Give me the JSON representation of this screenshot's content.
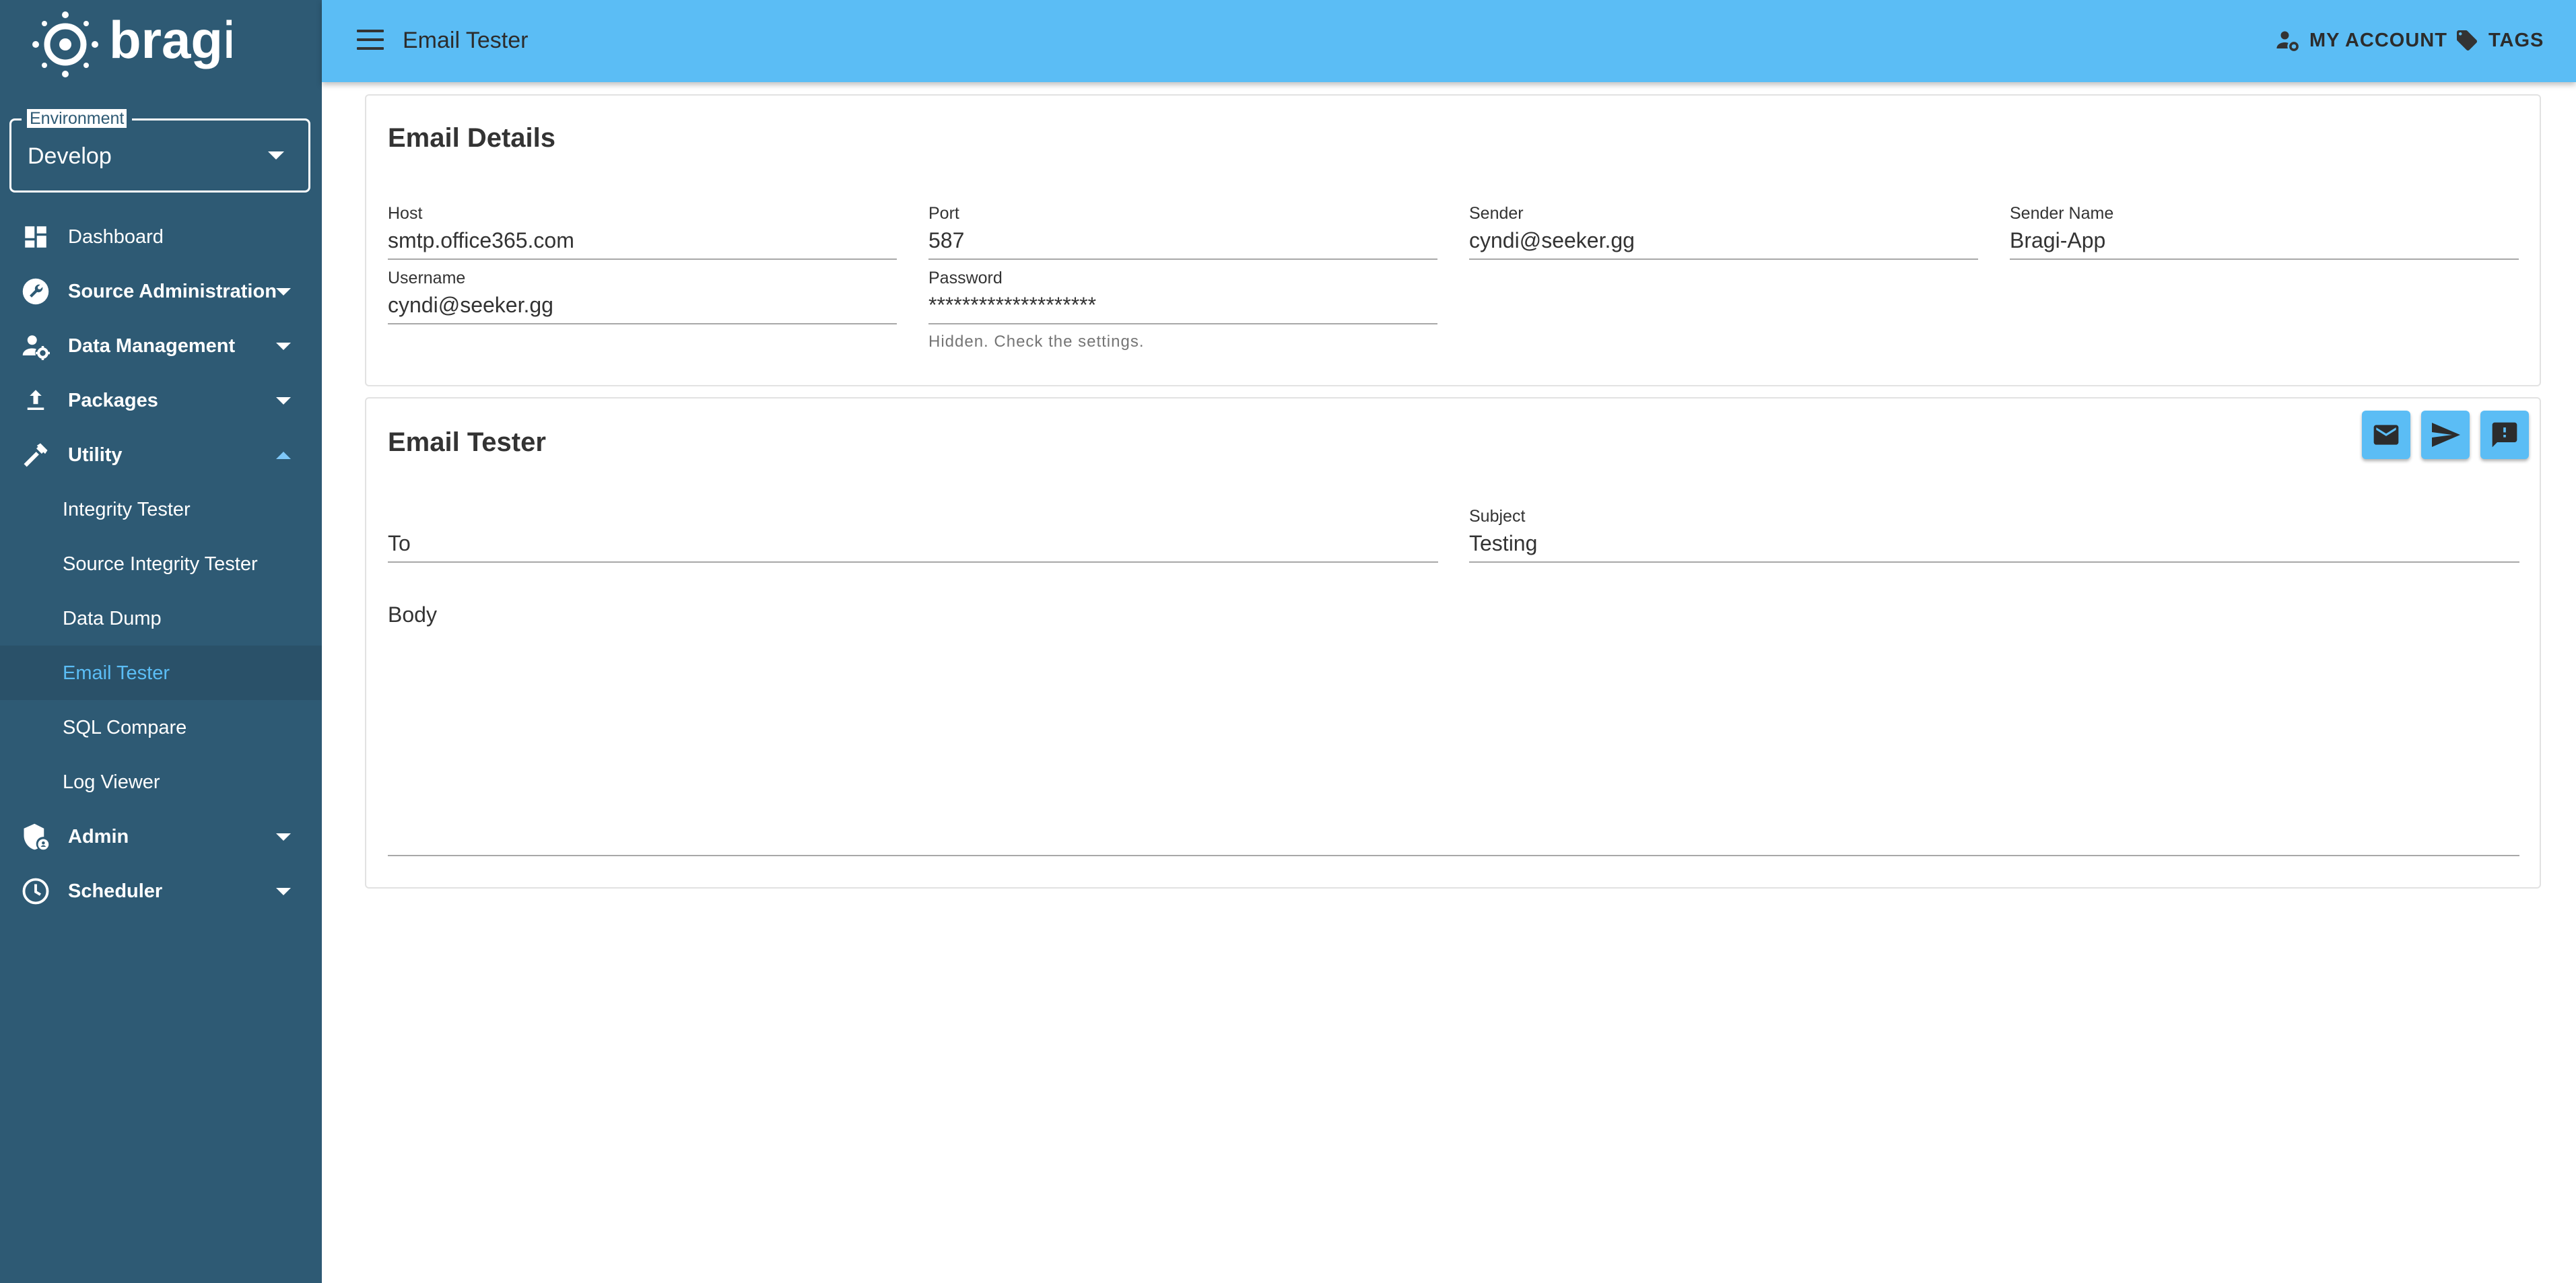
{
  "app": {
    "logo_text": "bragi"
  },
  "environment": {
    "label": "Environment",
    "value": "Develop"
  },
  "sidebar": {
    "items": [
      {
        "label": "Dashboard",
        "icon": "dashboard-icon"
      },
      {
        "label": "Source Administration",
        "icon": "wrench-icon"
      },
      {
        "label": "Data Management",
        "icon": "user-gear-icon"
      },
      {
        "label": "Packages",
        "icon": "upload-icon"
      },
      {
        "label": "Utility",
        "icon": "hammer-icon"
      },
      {
        "label": "Admin",
        "icon": "shield-icon"
      },
      {
        "label": "Scheduler",
        "icon": "clock-icon"
      }
    ],
    "utility_sub": [
      {
        "label": "Integrity Tester"
      },
      {
        "label": "Source Integrity Tester"
      },
      {
        "label": "Data Dump"
      },
      {
        "label": "Email Tester"
      },
      {
        "label": "SQL Compare"
      },
      {
        "label": "Log Viewer"
      }
    ],
    "active_sub": "Email Tester"
  },
  "topbar": {
    "title": "Email Tester",
    "my_account": "MY ACCOUNT",
    "tags": "TAGS"
  },
  "email_details": {
    "title": "Email Details",
    "host": {
      "label": "Host",
      "value": "smtp.office365.com"
    },
    "port": {
      "label": "Port",
      "value": "587"
    },
    "sender": {
      "label": "Sender",
      "value": "cyndi@seeker.gg"
    },
    "sender_name": {
      "label": "Sender Name",
      "value": "Bragi-App"
    },
    "username": {
      "label": "Username",
      "value": "cyndi@seeker.gg"
    },
    "password": {
      "label": "Password",
      "value": "********************",
      "hint": "Hidden. Check the settings."
    }
  },
  "email_tester": {
    "title": "Email Tester",
    "to": {
      "placeholder": "To",
      "value": ""
    },
    "subject": {
      "label": "Subject",
      "value": "Testing"
    },
    "body": {
      "placeholder": "Body",
      "value": ""
    },
    "actions": [
      "mail-icon",
      "send-icon",
      "feedback-icon"
    ]
  },
  "colors": {
    "sidebar": "#2e5a74",
    "topbar": "#5bbdf5",
    "active_text": "#5bbdf5"
  }
}
